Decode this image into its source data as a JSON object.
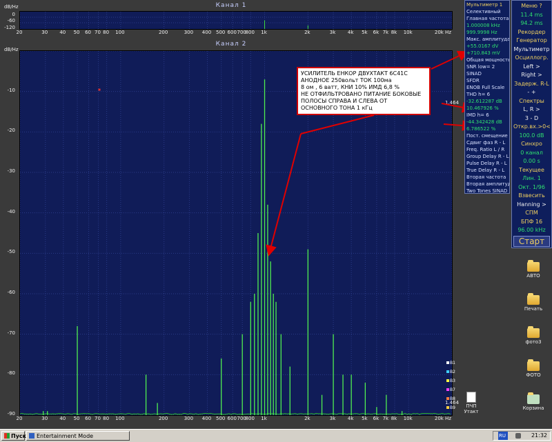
{
  "channel1": {
    "title": "Канал 1",
    "unit_label": "dB/Hz",
    "y_ticks": [
      "0",
      "-60",
      "-120"
    ],
    "x_ticks": [
      "20",
      "30",
      "40",
      "50",
      "60",
      "70",
      "80",
      "100",
      "200",
      "300",
      "400",
      "500",
      "600",
      "700",
      "800",
      "1k",
      "2k",
      "3k",
      "4k",
      "5k",
      "6k",
      "7k",
      "8k",
      "10k",
      "20k Hz"
    ]
  },
  "channel2": {
    "title": "Канал 2",
    "unit_label": "dB/Hz",
    "x_ticks": [
      "20",
      "30",
      "40",
      "50",
      "60",
      "70",
      "80",
      "100",
      "200",
      "300",
      "400",
      "500",
      "600",
      "700",
      "800",
      "1k",
      "2k",
      "3k",
      "4k",
      "5k",
      "6k",
      "7k",
      "8k",
      "10k",
      "20k Hz"
    ],
    "side_value": "1.464",
    "legend": [
      "B1",
      "B2",
      "B3",
      "B7",
      "B8",
      "B9"
    ]
  },
  "chart_data": {
    "type": "line",
    "xlabel": "Hz",
    "ylabel": "dB/Hz",
    "x_scale": "log",
    "xlim": [
      20,
      20000
    ],
    "ylim": [
      -90,
      0
    ],
    "y_ticks": [
      0,
      -10,
      -20,
      -30,
      -40,
      -50,
      -60,
      -70,
      -80,
      -90
    ],
    "peaks": [
      {
        "x": 29,
        "y": -89
      },
      {
        "x": 31,
        "y": -89
      },
      {
        "x": 50,
        "y": -68
      },
      {
        "x": 150,
        "y": -80
      },
      {
        "x": 180,
        "y": -87
      },
      {
        "x": 500,
        "y": -76
      },
      {
        "x": 700,
        "y": -70
      },
      {
        "x": 800,
        "y": -62
      },
      {
        "x": 850,
        "y": -60
      },
      {
        "x": 900,
        "y": -45
      },
      {
        "x": 950,
        "y": -18
      },
      {
        "x": 1000,
        "y": -7
      },
      {
        "x": 1050,
        "y": -38
      },
      {
        "x": 1100,
        "y": -52
      },
      {
        "x": 1150,
        "y": -60
      },
      {
        "x": 1200,
        "y": -62
      },
      {
        "x": 1300,
        "y": -70
      },
      {
        "x": 1500,
        "y": -78
      },
      {
        "x": 2000,
        "y": -49
      },
      {
        "x": 2500,
        "y": -85
      },
      {
        "x": 3000,
        "y": -70
      },
      {
        "x": 3500,
        "y": -80
      },
      {
        "x": 4000,
        "y": -80
      },
      {
        "x": 5000,
        "y": -82
      },
      {
        "x": 6000,
        "y": -88
      },
      {
        "x": 7000,
        "y": -85
      },
      {
        "x": 9000,
        "y": -89
      }
    ]
  },
  "annotation": {
    "lines": [
      "УСИЛИТЕЛЬ ЕНКОР ДВУХТАКТ 6С41С",
      " АНОДНОЕ 250вольт  ТОК 100ма",
      "8 ом , 6 ватт, КНИ 10%  ИМД 6,8 %",
      " НЕ ОТФИЛЬТРОВАНО ПИТАНИЕ БОКОВЫЕ",
      " ПОЛОСЫ СПРАВА И СЛЕВА ОТ",
      "ОСНОВНОГО ТОНА 1 кГц"
    ]
  },
  "multimeter": {
    "title": "Мультиметр 1",
    "rows": [
      {
        "t": "Селективный",
        "c": "lab"
      },
      {
        "t": "Главная частота",
        "c": "lab"
      },
      {
        "t": "1.000008 kHz",
        "c": "val"
      },
      {
        "t": "999.9998 Hz",
        "c": "val"
      },
      {
        "t": "Макс. амплитуда",
        "c": "lab"
      },
      {
        "t": "+55.0167 dV",
        "c": "val"
      },
      {
        "t": "+710.843 mV",
        "c": "val"
      },
      {
        "t": "Общая мощность",
        "c": "lab"
      },
      {
        "t": "SNR    low= 2",
        "c": "lab"
      },
      {
        "t": "SINAD",
        "c": "lab"
      },
      {
        "t": "SFDR",
        "c": "lab"
      },
      {
        "t": "ENOB  Full Scale",
        "c": "lab"
      },
      {
        "t": "THD    h=  6",
        "c": "lab"
      },
      {
        "t": "-32.612287 dB",
        "c": "val"
      },
      {
        "t": "10.467926 %",
        "c": "val"
      },
      {
        "t": "IMD     h=  6",
        "c": "lab"
      },
      {
        "t": "-44.342428 dB",
        "c": "val"
      },
      {
        "t": "6.786522 %",
        "c": "val"
      },
      {
        "t": "Пост. смещение",
        "c": "lab"
      },
      {
        "t": "Сдвиг фаз R - L",
        "c": "lab"
      },
      {
        "t": "Freq. Ratio  L / R",
        "c": "lab"
      },
      {
        "t": "Group Delay R - L",
        "c": "lab"
      },
      {
        "t": "Pulse Delay R - L",
        "c": "lab"
      },
      {
        "t": "True Delay R - L",
        "c": "lab"
      },
      {
        "t": "Вторая частота",
        "c": "lab"
      },
      {
        "t": "Вторая амплитуда",
        "c": "lab"
      },
      {
        "t": "Two Tones SINAD",
        "c": "lab"
      }
    ]
  },
  "controls": {
    "rows": [
      {
        "t": "Меню   ?",
        "c": "hdr"
      },
      {
        "t": "11.4 ms",
        "c": "val"
      },
      {
        "t": "94.2 ms",
        "c": "val"
      },
      {
        "t": "Рекордер",
        "c": "hdr"
      },
      {
        "t": "Генератор",
        "c": "hdr"
      },
      {
        "t": "Мультиметр",
        "c": "opt"
      },
      {
        "t": "Осциллогр.",
        "c": "hdr"
      },
      {
        "t": "Left  >",
        "c": "opt"
      },
      {
        "t": "Right  >",
        "c": "opt"
      },
      {
        "t": "Задерж. R-L",
        "c": "hdr"
      },
      {
        "t": "-    +",
        "c": "opt"
      },
      {
        "t": "Спектры",
        "c": "hdr"
      },
      {
        "t": "L, R  >",
        "c": "opt"
      },
      {
        "t": "3 - D",
        "c": "opt"
      },
      {
        "t": "Откр.вх.>0<",
        "c": "hdr"
      },
      {
        "t": "100.0 dB",
        "c": "val"
      },
      {
        "t": "Синхро",
        "c": "hdr"
      },
      {
        "t": "0 канал",
        "c": "val"
      },
      {
        "t": "0.00 s",
        "c": "val"
      },
      {
        "t": "Текущее",
        "c": "hdr"
      },
      {
        "t": "Лин.   1",
        "c": "val"
      },
      {
        "t": "Окт. 1/96",
        "c": "val"
      },
      {
        "t": "Взвесить",
        "c": "hdr"
      },
      {
        "t": "Hanning >",
        "c": "opt"
      },
      {
        "t": "СПМ",
        "c": "hdr"
      },
      {
        "t": "БПФ  16",
        "c": "hdr"
      },
      {
        "t": "96.00 kHz",
        "c": "val"
      },
      {
        "t": "Старт",
        "c": "hdr"
      }
    ]
  },
  "desktop": {
    "icons": [
      {
        "label": "АВТО"
      },
      {
        "label": "Печать"
      },
      {
        "label": "фото3"
      },
      {
        "label": "ФОТО"
      },
      {
        "label": "Корзина"
      }
    ],
    "tray_file": "ПЧП Утакт"
  },
  "taskbar": {
    "start": "Пуск",
    "window": "Entertainment Mode",
    "lang": "RU",
    "clock": "21:32"
  }
}
